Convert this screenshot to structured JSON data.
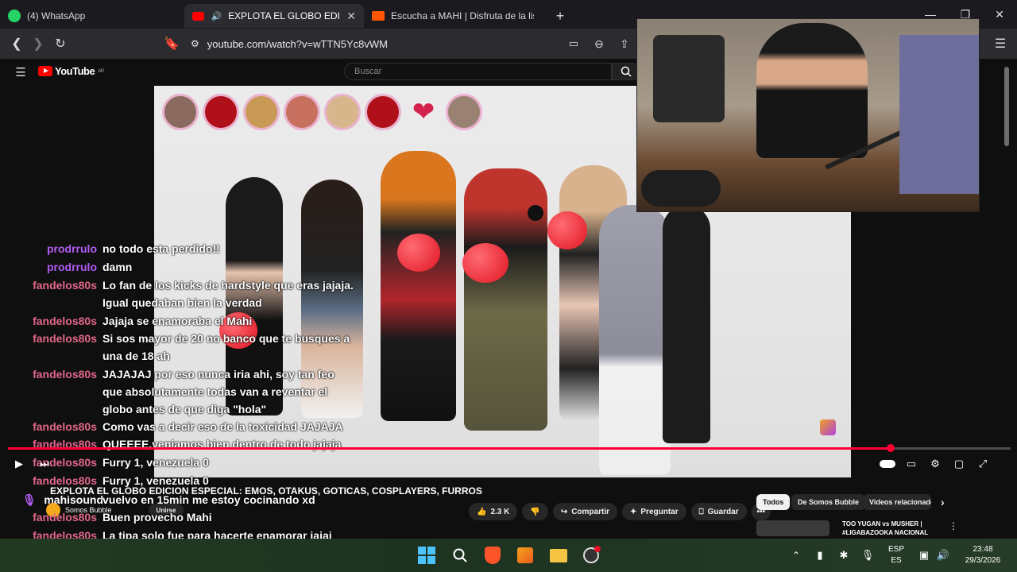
{
  "browser": {
    "tabs": [
      {
        "label": "(4) WhatsApp"
      },
      {
        "label": "EXPLOTA EL GLOBO EDICION"
      },
      {
        "label": "Escucha a MAHI | Disfruta de la lista"
      }
    ],
    "new_tab": "+",
    "url": "youtube.com/watch?v=wTTN5Yc8vWM"
  },
  "youtube": {
    "logo_text": "YouTube",
    "logo_sup": "AR",
    "search_placeholder": "Buscar"
  },
  "video": {
    "title": "EXPLOTA EL GLOBO EDICION ESPECIAL: EMOS, OTAKUS, GOTICAS, COSPLAYERS, FURROS",
    "channel": "Somos Bubble",
    "join_label": "Unirse",
    "likes": "2.3 K",
    "share_label": "Compartir",
    "ask_label": "Preguntar",
    "save_label": "Guardar",
    "progress_fraction": 0.88
  },
  "filter_chips": [
    "Todos",
    "De Somos Bubble",
    "Videos relacionado"
  ],
  "related_preview": {
    "title": "TOO YUGAN vs MUSHER |",
    "subtitle": "#LIGABAZOOKA NACIONAL"
  },
  "chat": [
    {
      "user": "prodrrulo",
      "color": "purple",
      "lines": [
        "no todo esta perdido!!"
      ]
    },
    {
      "user": "prodrrulo",
      "color": "purple",
      "lines": [
        "damn"
      ]
    },
    {
      "user": "fandelos80s",
      "color": "pink",
      "lines": [
        "Lo fan de los kicks de hardstyle que eras jajaja.",
        "Igual quedaban bien la verdad"
      ]
    },
    {
      "user": "fandelos80s",
      "color": "pink",
      "lines": [
        "Jajaja se enamoraba el Mahi"
      ]
    },
    {
      "user": "fandelos80s",
      "color": "pink",
      "lines": [
        "Si sos mayor de 20 no banco que te busques a",
        "una de 18 ah"
      ]
    },
    {
      "user": "fandelos80s",
      "color": "pink",
      "lines": [
        "JAJAJAJ por eso nunca iria ahi, soy tan feo",
        "que absolutamente todas van a reventar el",
        "globo antes de que diga \"hola\""
      ]
    },
    {
      "user": "fandelos80s",
      "color": "pink",
      "lines": [
        "Como vas a decir eso de la toxicidad JAJAJA"
      ]
    },
    {
      "user": "fandelos80s",
      "color": "pink",
      "lines": [
        "QUEEEE,veniamos bien dentro de todo jajaja"
      ]
    },
    {
      "user": "fandelos80s",
      "color": "pink",
      "lines": [
        "Furry 1, venezuela 0"
      ]
    },
    {
      "user": "fandelos80s",
      "color": "pink",
      "lines": [
        "Furry 1, venezuela 0"
      ]
    },
    {
      "user": "mahisound",
      "color": "white",
      "lines": [
        "vuelvo en 15min me estoy cocinando xd"
      ]
    },
    {
      "user": "fandelos80s",
      "color": "pink",
      "lines": [
        "Buen provecho Mahi"
      ]
    },
    {
      "user": "fandelos80s",
      "color": "pink",
      "lines": [
        "La tipa solo fue para hacerte enamorar jajaj"
      ]
    }
  ],
  "taskbar": {
    "lang_top": "ESP",
    "lang_bottom": "ES",
    "time": "23:48",
    "date": "29/3/2026"
  }
}
